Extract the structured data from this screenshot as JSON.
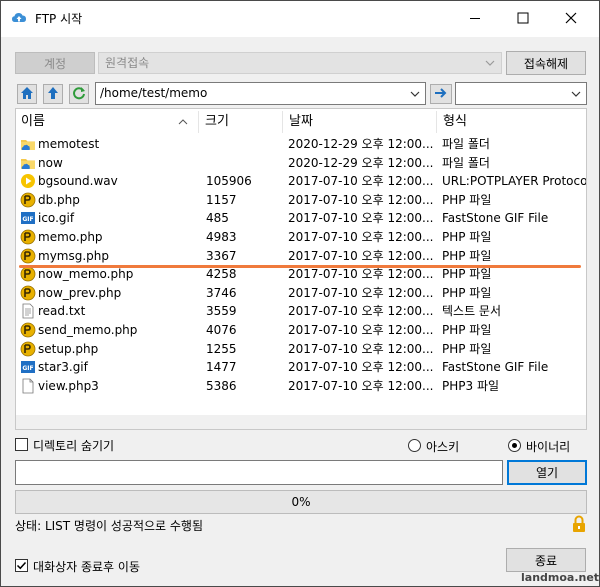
{
  "window": {
    "title": "FTP 시작"
  },
  "account": {
    "button_label": "계정",
    "server_value": "원격접속",
    "disconnect_label": "접속해제"
  },
  "path": {
    "current": "/home/test/memo",
    "local_drive": ""
  },
  "file_list": {
    "columns": {
      "name": "이름",
      "size": "크기",
      "date": "날짜",
      "type": "형식"
    },
    "rows": [
      {
        "icon": "folder-cloud-icon",
        "name": "memotest",
        "size": "",
        "date": "2020-12-29  오후 12:00...",
        "type": "파일 폴더"
      },
      {
        "icon": "folder-cloud-icon",
        "name": "now",
        "size": "",
        "date": "2020-12-29  오후 12:00...",
        "type": "파일 폴더"
      },
      {
        "icon": "potplayer-icon",
        "name": "bgsound.wav",
        "size": "105906",
        "date": "2017-07-10  오후 12:00...",
        "type": "URL:POTPLAYER Protocol"
      },
      {
        "icon": "php-icon",
        "name": "db.php",
        "size": "1157",
        "date": "2017-07-10  오후 12:00...",
        "type": "PHP 파일"
      },
      {
        "icon": "gif-icon",
        "name": "ico.gif",
        "size": "485",
        "date": "2017-07-10  오후 12:00...",
        "type": "FastStone GIF File"
      },
      {
        "icon": "php-icon",
        "name": "memo.php",
        "size": "4983",
        "date": "2017-07-10  오후 12:00...",
        "type": "PHP 파일"
      },
      {
        "icon": "php-icon",
        "name": "mymsg.php",
        "size": "3367",
        "date": "2017-07-10  오후 12:00...",
        "type": "PHP 파일"
      },
      {
        "icon": "php-icon",
        "name": "now_memo.php",
        "size": "4258",
        "date": "2017-07-10  오후 12:00...",
        "type": "PHP 파일"
      },
      {
        "icon": "php-icon",
        "name": "now_prev.php",
        "size": "3746",
        "date": "2017-07-10  오후 12:00...",
        "type": "PHP 파일"
      },
      {
        "icon": "text-file-icon",
        "name": "read.txt",
        "size": "3559",
        "date": "2017-07-10  오후 12:00...",
        "type": "텍스트 문서"
      },
      {
        "icon": "php-icon",
        "name": "send_memo.php",
        "size": "4076",
        "date": "2017-07-10  오후 12:00...",
        "type": "PHP 파일"
      },
      {
        "icon": "php-icon",
        "name": "setup.php",
        "size": "1255",
        "date": "2017-07-10  오후 12:00...",
        "type": "PHP 파일"
      },
      {
        "icon": "gif-icon",
        "name": "star3.gif",
        "size": "1477",
        "date": "2017-07-10  오후 12:00...",
        "type": "FastStone GIF File"
      },
      {
        "icon": "blank-file-icon",
        "name": "view.php3",
        "size": "5386",
        "date": "2017-07-10  오후 12:00...",
        "type": "PHP3 파일"
      }
    ]
  },
  "options": {
    "hide_dirs_label": "디렉토리 숨기기",
    "hide_dirs_checked": false,
    "ascii_label": "아스키",
    "binary_label": "바이너리",
    "transfer_mode": "binary"
  },
  "command": {
    "input_value": "",
    "open_label": "열기"
  },
  "progress": {
    "percent_label": "0%",
    "value": 0
  },
  "status": {
    "text": "상태: LIST 명령이 성공적으로 수행됨"
  },
  "footer": {
    "move_after_close_label": "대화상자 종료후 이동",
    "move_after_close_checked": true,
    "close_label": "종료",
    "watermark": "landmoa.net"
  },
  "colors": {
    "accent": "#0078d7",
    "annotation_line": "#f07a3c",
    "php_icon": "#e8b100",
    "folder": "#f5c94c",
    "nav_arrow": "#1e6fbf",
    "refresh": "#2e9b3a",
    "lock": "#e8a400"
  }
}
